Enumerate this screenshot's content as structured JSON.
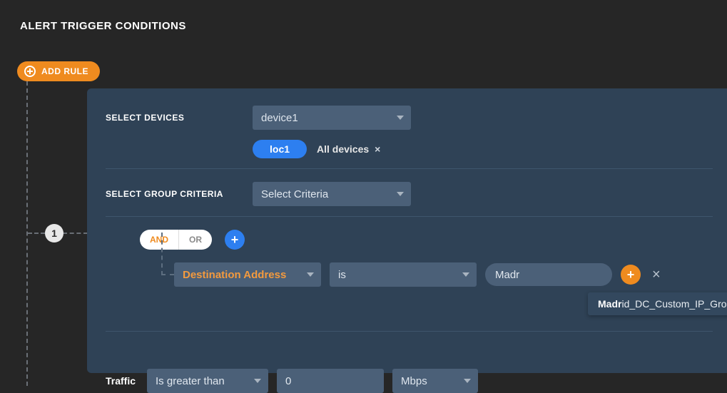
{
  "title": "ALERT TRIGGER CONDITIONS",
  "add_rule_label": "ADD RULE",
  "node_number": "1",
  "devices": {
    "label": "SELECT DEVICES",
    "selected": "device1",
    "chip": "loc1",
    "all_devices_label": "All devices"
  },
  "group_criteria": {
    "label": "SELECT GROUP CRITERIA",
    "placeholder": "Select Criteria"
  },
  "logic": {
    "and": "AND",
    "or": "OR"
  },
  "condition": {
    "field": "Destination Address",
    "operator": "is",
    "value_typed": "Madr",
    "suggestion_bold": "Madr",
    "suggestion_rest": "id_DC_Custom_IP_Group"
  },
  "traffic": {
    "label": "Traffic",
    "comparator": "Is greater than",
    "value": "0",
    "unit": "Mbps"
  }
}
